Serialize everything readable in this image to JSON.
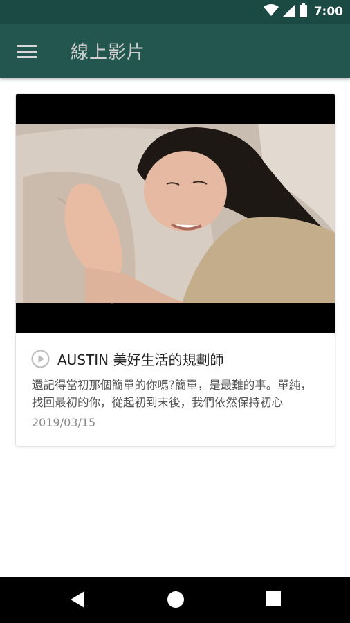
{
  "status_bar": {
    "time": "7:00",
    "icons": [
      "wifi-icon",
      "signal-icon",
      "battery-icon"
    ]
  },
  "app_bar": {
    "menu_icon": "hamburger-menu-icon",
    "title": "線上影片"
  },
  "videos": [
    {
      "title": "AUSTIN 美好生活的規劃師",
      "description": "還記得當初那個簡單的你嗎?簡單，是最難的事。單純，找回最初的你，從起初到末後，我們依然保持初心",
      "date": "2019/03/15",
      "play_icon": "play-circle-icon"
    }
  ],
  "nav_bar": {
    "icons": [
      "back-icon",
      "home-icon",
      "recents-icon"
    ]
  },
  "colors": {
    "status_bar": "#1b4a45",
    "app_bar": "#245650",
    "title_text": "#cfcfcf"
  }
}
